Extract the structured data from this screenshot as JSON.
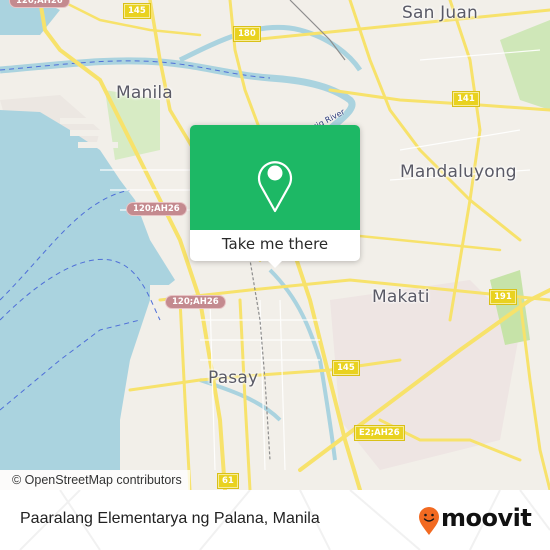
{
  "map": {
    "place_labels": {
      "manila": "Manila",
      "san_juan": "San Juan",
      "mandaluyong": "Mandaluyong",
      "makati": "Makati",
      "pasay": "Pasay"
    },
    "river_label": "Pasig River",
    "route_shields": [
      {
        "id": "r145_top",
        "label": "145",
        "style": "yellow"
      },
      {
        "id": "r180",
        "label": "180",
        "style": "yellow"
      },
      {
        "id": "r141",
        "label": "141",
        "style": "yellow"
      },
      {
        "id": "r191",
        "label": "191",
        "style": "yellow"
      },
      {
        "id": "r145_mid",
        "label": "145",
        "style": "yellow"
      },
      {
        "id": "e2ah26",
        "label": "E2;AH26",
        "style": "yellow"
      },
      {
        "id": "r61",
        "label": "61",
        "style": "yellow"
      },
      {
        "id": "ah26_top",
        "label": "120;AH26",
        "style": "red"
      },
      {
        "id": "ah26_mid",
        "label": "120;AH26",
        "style": "red"
      },
      {
        "id": "ah26_low",
        "label": "120;AH26",
        "style": "red"
      }
    ],
    "colors": {
      "water": "#aad3df",
      "land": "#f2efe9",
      "road": "#f7e26b",
      "park": "#c8e6b0",
      "popup_green": "#1db865"
    }
  },
  "popup": {
    "icon": "map-pin-icon",
    "button_label": "Take me there"
  },
  "attribution": "© OpenStreetMap contributors",
  "footer": {
    "place_name": "Paaralang Elementarya ng Palana, Manila",
    "brand": "moovit",
    "brand_icon": "moovit-smiley-pin-icon",
    "brand_color": "#f26a21"
  }
}
